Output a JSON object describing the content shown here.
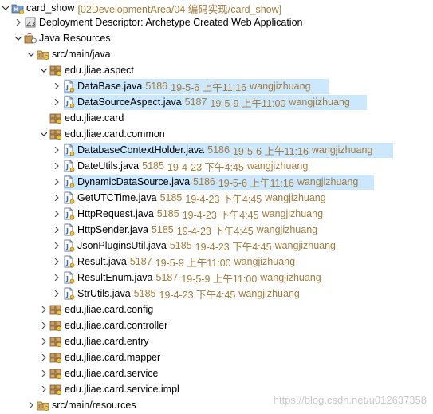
{
  "tree": {
    "project": {
      "name": "card_show",
      "decoration": "[02DevelopmentArea/04 编码实现/card_show]"
    },
    "deployment_descriptor": "Deployment Descriptor: Archetype Created Web Application",
    "java_resources": "Java Resources",
    "src_main_java": "src/main/java",
    "pkg_aspect": "edu.jliae.aspect",
    "file_database": {
      "name": "DataBase.java",
      "revision": "5186",
      "date": "19-5-6 上午11:16",
      "author": "wangjizhuang"
    },
    "file_datasourceaspect": {
      "name": "DataSourceAspect.java",
      "revision": "5187",
      "date": "19-5-9 上午11:00",
      "author": "wangjizhuang"
    },
    "pkg_card": "edu.jliae.card",
    "pkg_common": "edu.jliae.card.common",
    "file_dbcontextholder": {
      "name": "DatabaseContextHolder.java",
      "revision": "5186",
      "date": "19-5-6 上午11:16",
      "author": "wangjizhuang"
    },
    "file_dateutils": {
      "name": "DateUtils.java",
      "revision": "5185",
      "date": "19-4-23 下午4:45",
      "author": "wangjizhuang"
    },
    "file_dynamicds": {
      "name": "DynamicDataSource.java",
      "revision": "5186",
      "date": "19-5-6 上午11:16",
      "author": "wangjizhuang"
    },
    "file_getutctime": {
      "name": "GetUTCTime.java",
      "revision": "5185",
      "date": "19-4-23 下午4:45",
      "author": "wangjizhuang"
    },
    "file_httprequest": {
      "name": "HttpRequest.java",
      "revision": "5185",
      "date": "19-4-23 下午4:45",
      "author": "wangjizhuang"
    },
    "file_httpsender": {
      "name": "HttpSender.java",
      "revision": "5185",
      "date": "19-4-23 下午4:45",
      "author": "wangjizhuang"
    },
    "file_jsonplugins": {
      "name": "JsonPluginsUtil.java",
      "revision": "5185",
      "date": "19-4-23 下午4:45",
      "author": "wangjizhuang"
    },
    "file_result": {
      "name": "Result.java",
      "revision": "5187",
      "date": "19-5-9 上午11:00",
      "author": "wangjizhuang"
    },
    "file_resultenum": {
      "name": "ResultEnum.java",
      "revision": "5187",
      "date": "19-5-9 上午11:00",
      "author": "wangjizhuang"
    },
    "file_strutils": {
      "name": "StrUtils.java",
      "revision": "5185",
      "date": "19-4-23 下午4:45",
      "author": "wangjizhuang"
    },
    "pkg_config": "edu.jliae.card.config",
    "pkg_controller": "edu.jliae.card.controller",
    "pkg_entry": "edu.jliae.card.entry",
    "pkg_mapper": "edu.jliae.card.mapper",
    "pkg_service": "edu.jliae.card.service",
    "pkg_service_impl": "edu.jliae.card.service.impl",
    "src_main_resources": "src/main/resources"
  },
  "watermark": "https://blog.csdn.net/u012637358",
  "colors": {
    "selection": "#cce8ff",
    "decoration": "#a37c3d",
    "package": "#8b5a2b",
    "java_file": "#2f6fb5"
  }
}
